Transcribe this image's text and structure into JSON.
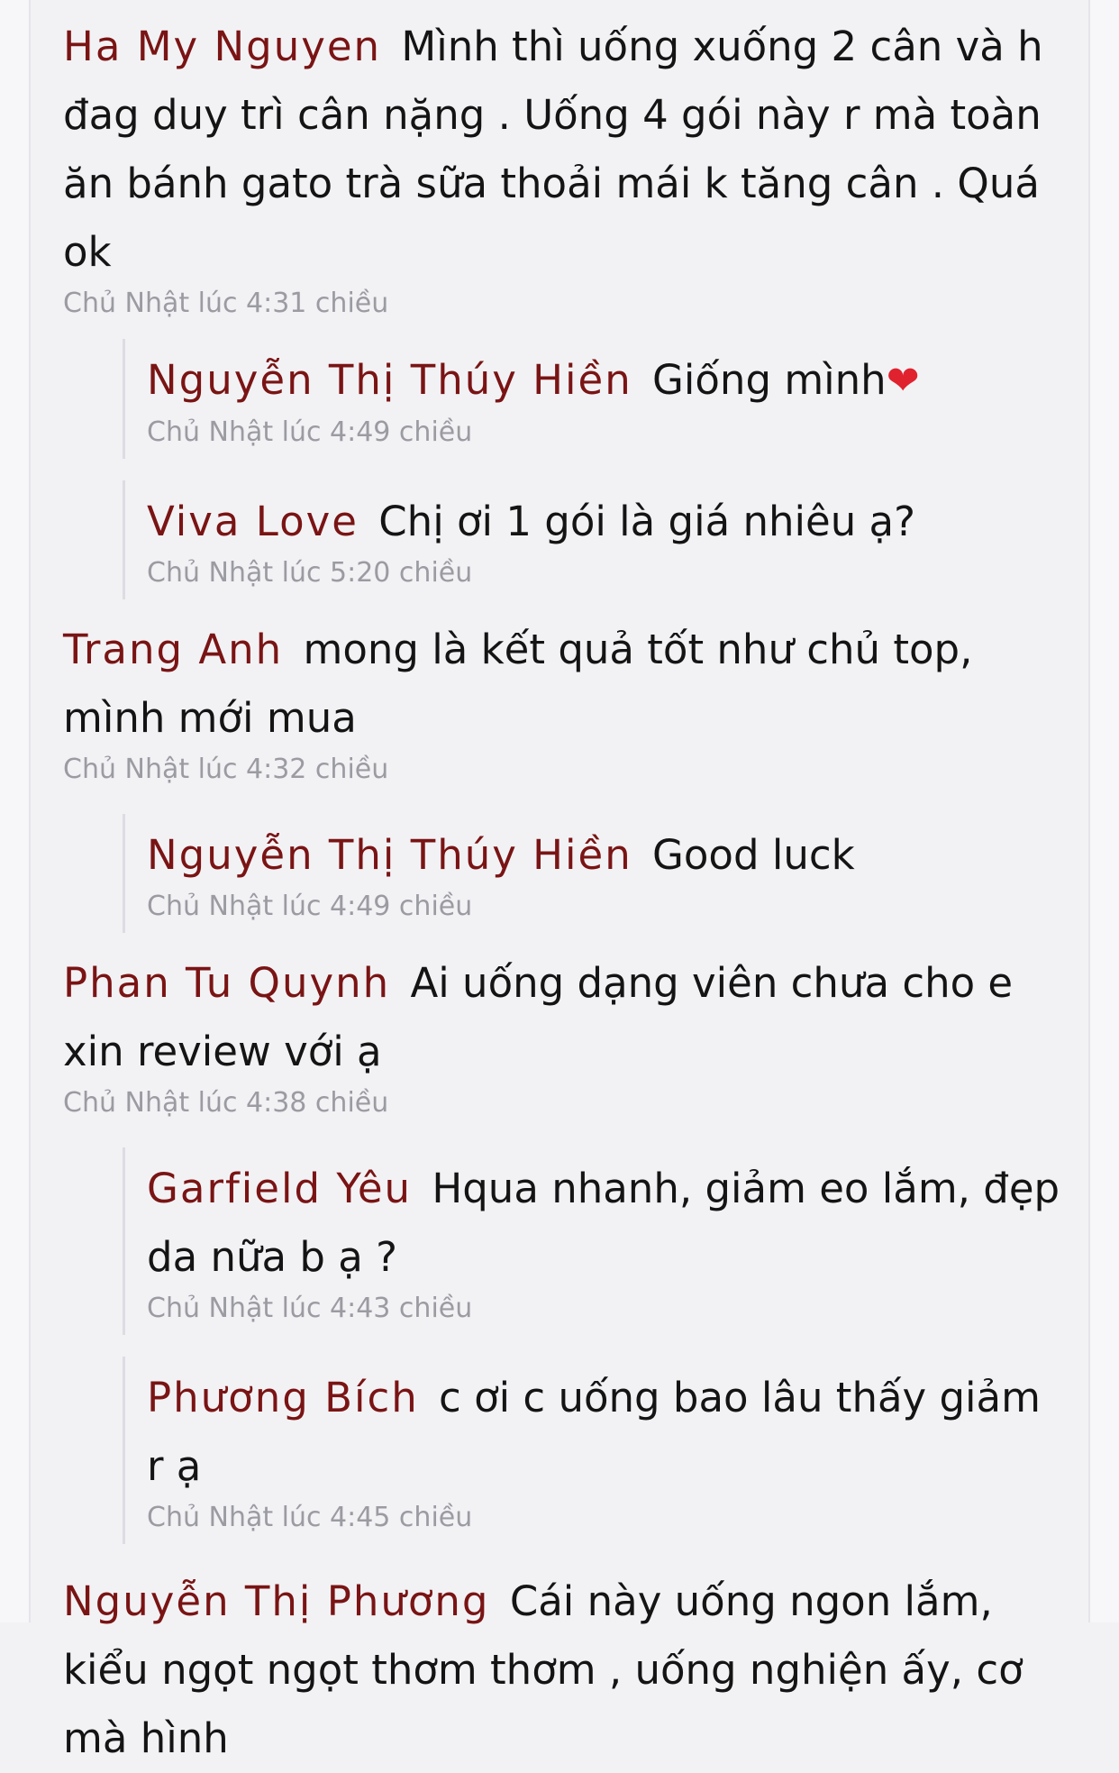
{
  "comments": [
    {
      "author": "Ha My Nguyen",
      "text": "Mình thì uống xuống 2 cân và h đag duy trì cân nặng . Uống 4 gói này r mà toàn ăn bánh gato trà sữa thoải mái k tăng cân . Quá ok",
      "time": "Chủ Nhật lúc 4:31 chiều",
      "replies": [
        {
          "author": "Nguyễn Thị Thúy Hiền",
          "text": "Giống mình",
          "emoji": "❤",
          "time": "Chủ Nhật lúc 4:49 chiều"
        },
        {
          "author": "Viva Love",
          "text": "Chị ơi 1 gói là giá nhiêu ạ?",
          "time": "Chủ Nhật lúc 5:20 chiều"
        }
      ]
    },
    {
      "author": "Trang Anh",
      "text": "mong là kết quả tốt như chủ top, mình mới mua",
      "time": "Chủ Nhật lúc 4:32 chiều",
      "replies": [
        {
          "author": "Nguyễn Thị Thúy Hiền",
          "text": "Good luck",
          "time": "Chủ Nhật lúc 4:49 chiều"
        }
      ]
    },
    {
      "author": "Phan Tu Quynh",
      "text": "Ai uống dạng viên chưa cho e xin review với ạ",
      "time": "Chủ Nhật lúc 4:38 chiều",
      "replies": [
        {
          "author": "Garfield Yêu",
          "text": "Hqua nhanh, giảm eo lắm, đẹp da nữa b ạ ?",
          "time": "Chủ Nhật lúc 4:43 chiều"
        },
        {
          "author": "Phương Bích",
          "text": "c ơi c uống bao lâu thấy giảm r ạ",
          "time": "Chủ Nhật lúc 4:45 chiều"
        }
      ]
    },
    {
      "author": "Nguyễn Thị Phương",
      "text": "Cái này uống ngon lắm, kiểu ngọt ngọt thơm thơm , uống nghiện ấy, cơ mà hình",
      "time": "",
      "replies": []
    }
  ],
  "colors": {
    "author": "#7a1414",
    "text": "#141414",
    "timestamp": "#9b9ba2",
    "background": "#f2f2f5",
    "heart": "#e0222e"
  }
}
